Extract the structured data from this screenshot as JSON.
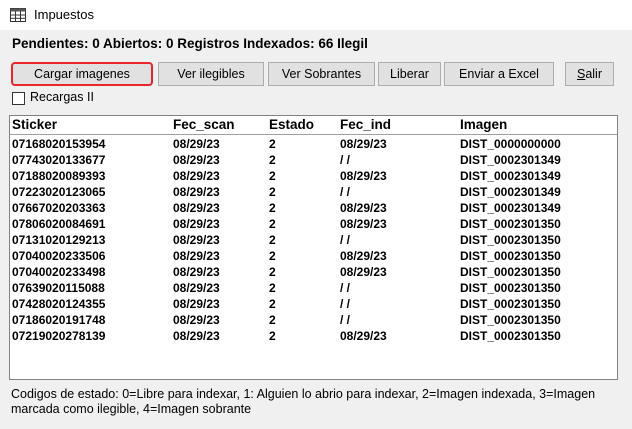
{
  "window": {
    "title": "Impuestos"
  },
  "summary": "Pendientes: 0 Abiertos: 0 Registros Indexados: 66 Ilegil",
  "toolbar": {
    "cargar": "Cargar imagenes",
    "ilegibles": "Ver ilegibles",
    "sobrantes": "Ver Sobrantes",
    "liberar": "Liberar",
    "excel": "Enviar a Excel",
    "salir_first": "S",
    "salir_rest": "alir"
  },
  "recargas": {
    "label": "Recargas II",
    "checked": false
  },
  "table": {
    "headers": [
      "Sticker",
      "Fec_scan",
      "Estado",
      "Fec_ind",
      "Imagen"
    ],
    "rows": [
      [
        "07168020153954",
        "08/29/23",
        "2",
        "08/29/23",
        "DIST_0000000000"
      ],
      [
        "07743020133677",
        "08/29/23",
        "2",
        "/ /",
        "DIST_0002301349"
      ],
      [
        "07188020089393",
        "08/29/23",
        "2",
        "08/29/23",
        "DIST_0002301349"
      ],
      [
        "07223020123065",
        "08/29/23",
        "2",
        "/ /",
        "DIST_0002301349"
      ],
      [
        "07667020203363",
        "08/29/23",
        "2",
        "08/29/23",
        "DIST_0002301349"
      ],
      [
        "07806020084691",
        "08/29/23",
        "2",
        "08/29/23",
        "DIST_0002301350"
      ],
      [
        "07131020129213",
        "08/29/23",
        "2",
        "/ /",
        "DIST_0002301350"
      ],
      [
        "07040020233506",
        "08/29/23",
        "2",
        "08/29/23",
        "DIST_0002301350"
      ],
      [
        "07040020233498",
        "08/29/23",
        "2",
        "08/29/23",
        "DIST_0002301350"
      ],
      [
        "07639020115088",
        "08/29/23",
        "2",
        "/ /",
        "DIST_0002301350"
      ],
      [
        "07428020124355",
        "08/29/23",
        "2",
        "/ /",
        "DIST_0002301350"
      ],
      [
        "07186020191748",
        "08/29/23",
        "2",
        "/ /",
        "DIST_0002301350"
      ],
      [
        "07219020278139",
        "08/29/23",
        "2",
        "08/29/23",
        "DIST_0002301350"
      ]
    ]
  },
  "legend": "Codigos de estado: 0=Libre para indexar, 1: Alguien lo abrio para indexar, 2=Imagen indexada, 3=Imagen marcada como ilegible, 4=Imagen sobrante",
  "colors": {
    "highlight": "#e8262b",
    "button_face": "#e1e1e1",
    "window_bg": "#f0f0f0"
  },
  "icons": {
    "app": "table-grid-icon"
  }
}
